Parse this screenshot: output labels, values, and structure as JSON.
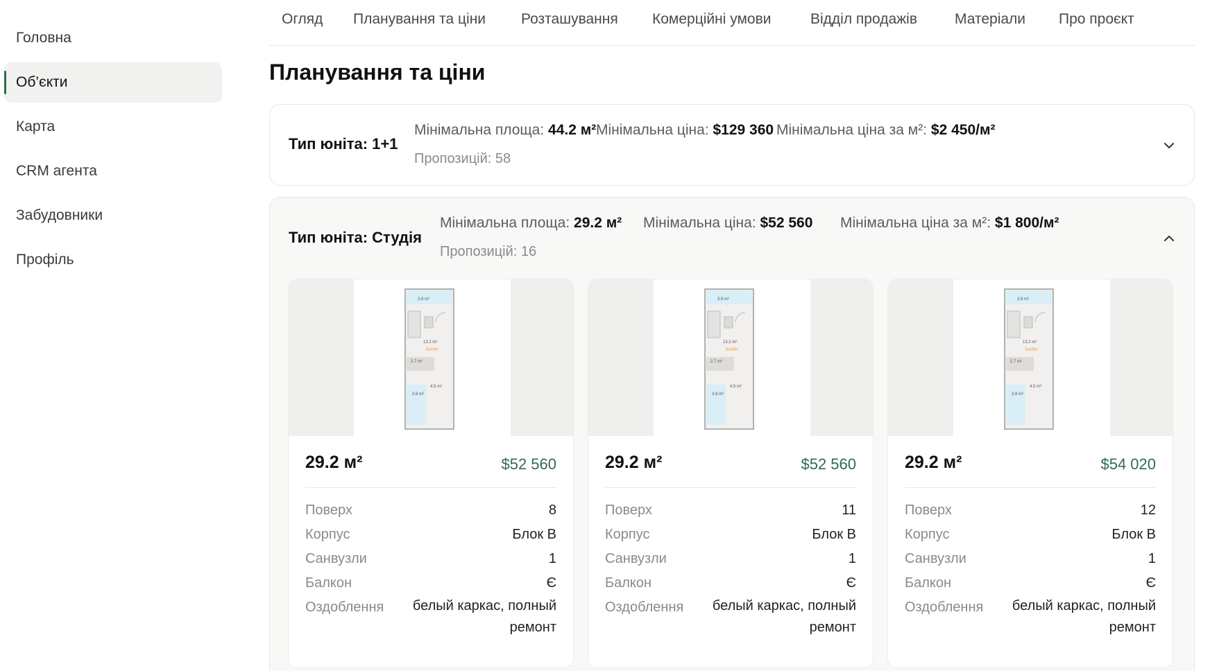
{
  "sidebar": {
    "items": [
      {
        "label": "Головна"
      },
      {
        "label": "Об’єкти"
      },
      {
        "label": "Карта"
      },
      {
        "label": "CRM агента"
      },
      {
        "label": "Забудовники"
      },
      {
        "label": "Профіль"
      }
    ],
    "active_index": 1
  },
  "tabs": [
    {
      "label": "Огляд"
    },
    {
      "label": "Планування та ціни"
    },
    {
      "label": "Розташування"
    },
    {
      "label": "Комерційні умови"
    },
    {
      "label": "Відділ продажів"
    },
    {
      "label": "Матеріали"
    },
    {
      "label": "Про проєкт"
    }
  ],
  "page_title": "Планування та ціни",
  "unit_types": [
    {
      "title": "Тип юніта: 1+1",
      "min_area_label": "Мінімальна площа:",
      "min_area_value": "44.2 м²",
      "min_price_label": "Мінімальна ціна:",
      "min_price_value": "$129 360",
      "min_price_m2_label": "Мінімальна ціна за м²:",
      "min_price_m2_value": "$2 450/м²",
      "offers": "Пропозицій: 58",
      "expanded": false
    },
    {
      "title": "Тип юніта: Студія",
      "min_area_label": "Мінімальна площа:",
      "min_area_value": "29.2 м²",
      "min_price_label": "Мінімальна ціна:",
      "min_price_value": "$52 560",
      "min_price_m2_label": "Мінімальна ціна за м²:",
      "min_price_m2_value": "$1 800/м²",
      "offers": "Пропозицій: 16",
      "expanded": true
    }
  ],
  "card_labels": {
    "floor": "Поверх",
    "building": "Корпус",
    "bathrooms": "Санвузли",
    "balcony": "Балкон",
    "finish": "Оздоблення"
  },
  "plan_labels": {
    "balcony": "3.9 m²",
    "room": "13.2 m²",
    "corridor": "2.7 m²",
    "bath": "3.8 m²",
    "hall": "4.5 m²",
    "watermark": "korter"
  },
  "cards": [
    {
      "area": "29.2 м²",
      "price": "$52 560",
      "floor": "8",
      "building": "Блок В",
      "bathrooms": "1",
      "balcony": "Є",
      "finish": "белый каркас, полный ремонт"
    },
    {
      "area": "29.2 м²",
      "price": "$52 560",
      "floor": "11",
      "building": "Блок В",
      "bathrooms": "1",
      "balcony": "Є",
      "finish": "белый каркас, полный ремонт"
    },
    {
      "area": "29.2 м²",
      "price": "$54 020",
      "floor": "12",
      "building": "Блок В",
      "bathrooms": "1",
      "balcony": "Є",
      "finish": "белый каркас, полный ремонт"
    }
  ],
  "colors": {
    "accent": "#2f6b4f",
    "price": "#2f6b4f",
    "active_bg": "#f1f1ef"
  }
}
